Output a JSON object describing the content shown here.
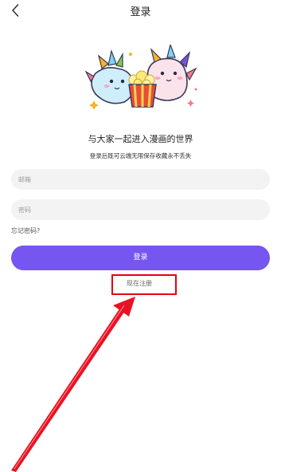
{
  "header": {
    "title": "登录"
  },
  "intro": {
    "headline": "与大家一起进入漫画的世界",
    "subline": "登录后既可云端无限保存收藏永不丢失"
  },
  "form": {
    "email_placeholder": "邮箱",
    "password_placeholder": "密码",
    "forgot_label": "忘记密码?",
    "login_label": "登录",
    "register_label": "现在注册"
  },
  "colors": {
    "accent": "#7655f0",
    "annotation_red": "#e60012"
  },
  "icons": {
    "back": "chevron-left-icon",
    "mascot": "mascot-illustration"
  }
}
